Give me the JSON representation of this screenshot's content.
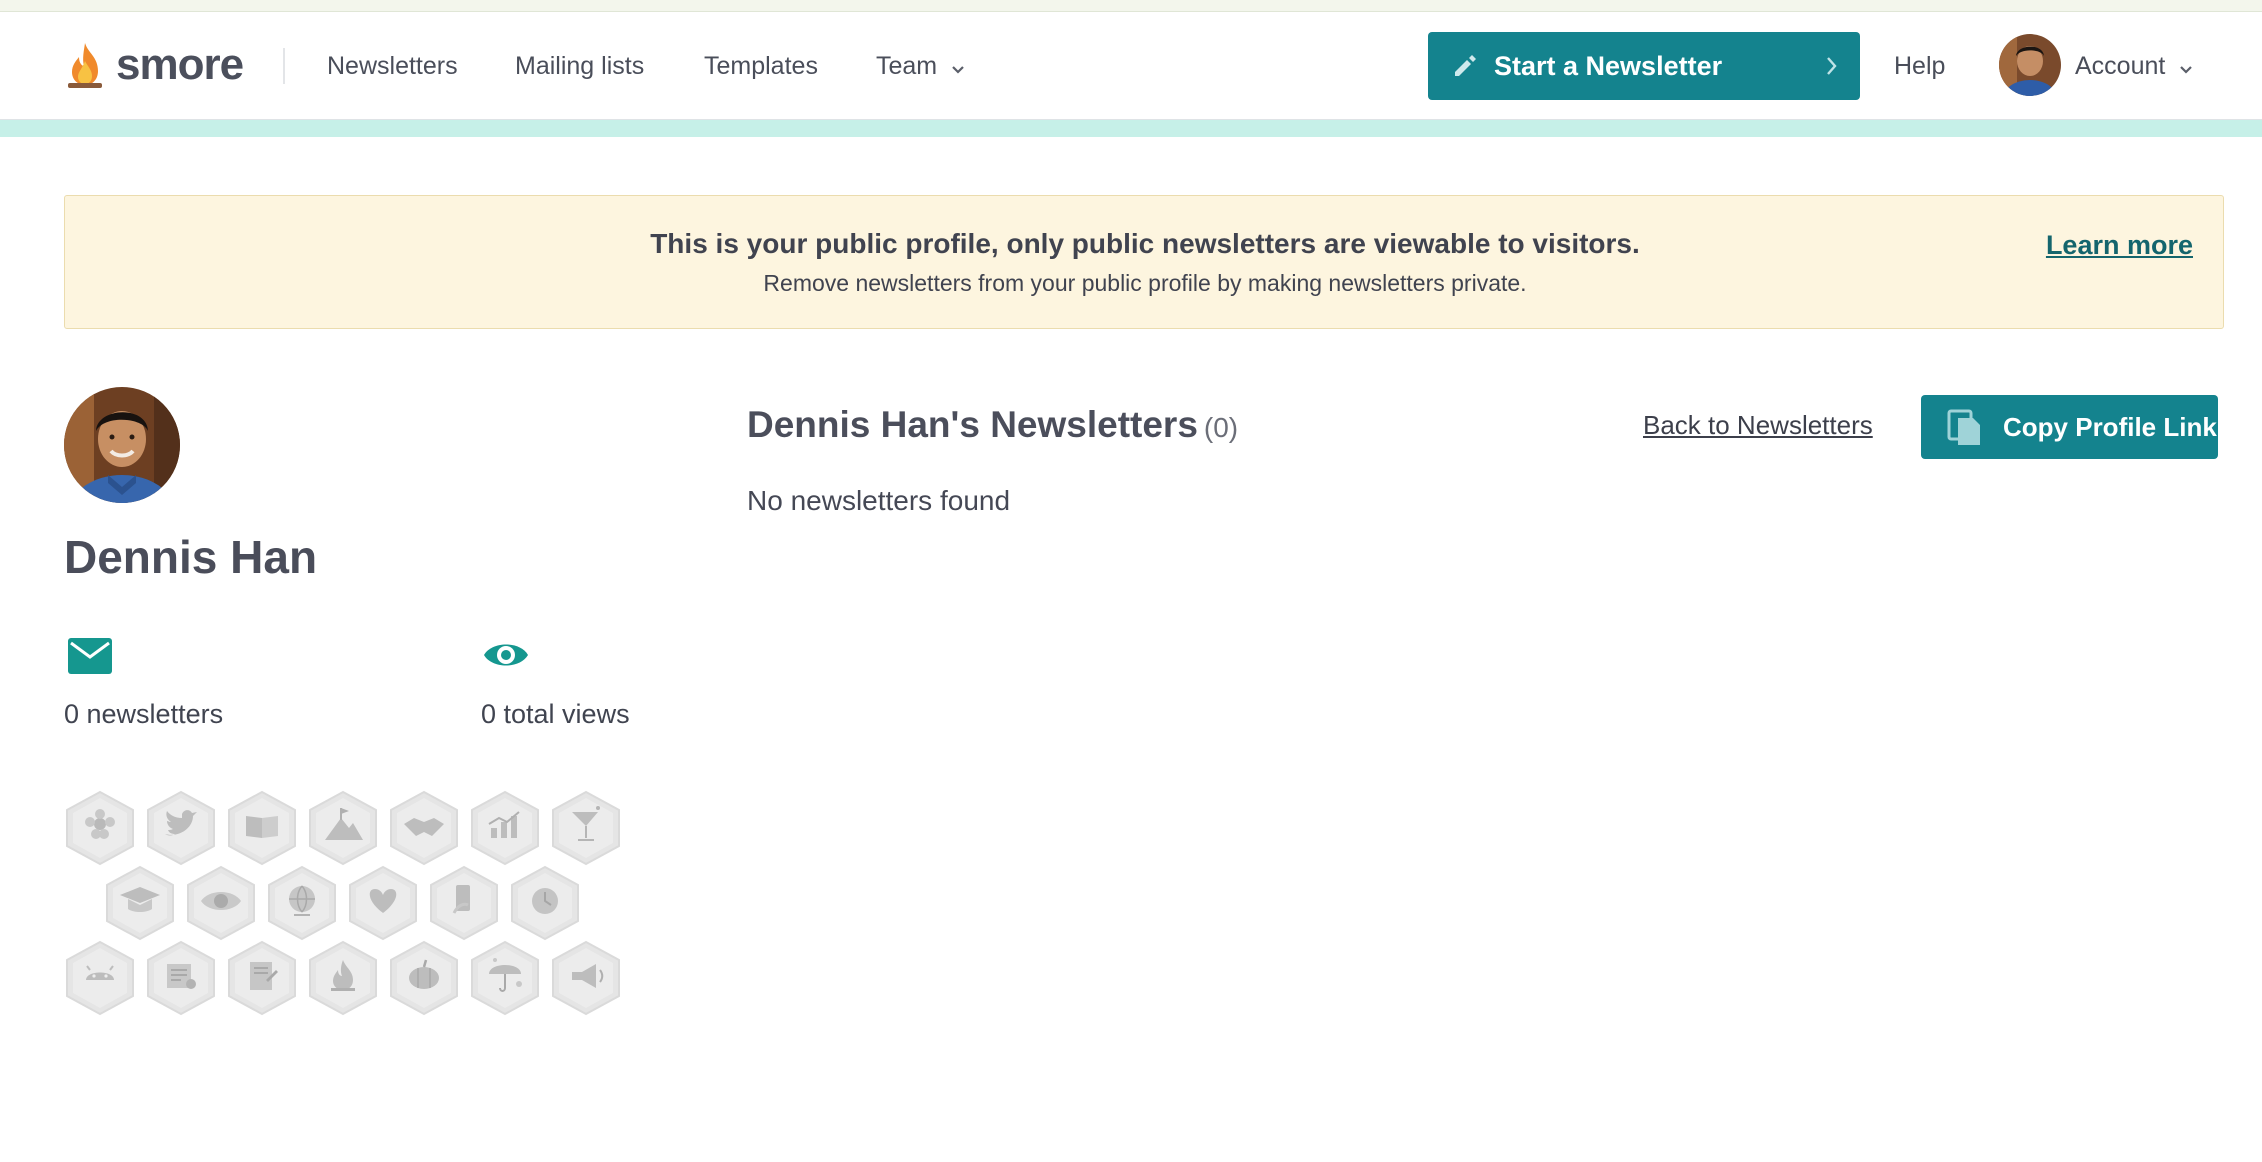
{
  "brand": {
    "name": "smore",
    "accent": "#14838e",
    "logo_icon": "flame-icon"
  },
  "nav": {
    "items": [
      {
        "label": "Newsletters"
      },
      {
        "label": "Mailing lists"
      },
      {
        "label": "Templates"
      },
      {
        "label": "Team",
        "icon": "chevron-down-icon"
      }
    ],
    "start_button": {
      "label": "Start a Newsletter",
      "icon": "pencil-icon",
      "trailing_icon": "chevron-right-icon"
    },
    "help": "Help",
    "account": {
      "label": "Account",
      "icon": "chevron-down-icon"
    }
  },
  "notice": {
    "title": "This is your public profile, only public newsletters are viewable to visitors.",
    "subtitle": "Remove newsletters from your public profile by making newsletters private.",
    "link": "Learn more",
    "background": "#fdf5df"
  },
  "profile": {
    "name": "Dennis Han",
    "stats": [
      {
        "icon": "envelope-icon",
        "text": "0 newsletters"
      },
      {
        "icon": "eye-icon",
        "text": "0 total views"
      }
    ],
    "badges": [
      [
        "flower-badge-icon",
        "twitter-badge-icon",
        "book-badge-icon",
        "mountain-flag-badge-icon",
        "handshake-badge-icon",
        "chart-badge-icon",
        "cocktail-badge-icon"
      ],
      [
        "graduation-cap-badge-icon",
        "eye-badge-icon",
        "globe-badge-icon",
        "heart-badge-icon",
        "phone-badge-icon",
        "clock-badge-icon"
      ],
      [
        "android-badge-icon",
        "newspaper-badge-icon",
        "document-badge-icon",
        "flame-badge-icon",
        "pumpkin-badge-icon",
        "umbrella-badge-icon",
        "megaphone-badge-icon"
      ]
    ]
  },
  "main": {
    "title": "Dennis Han's Newsletters",
    "count": "(0)",
    "empty_text": "No newsletters found",
    "back_link": "Back to Newsletters",
    "copy_button": {
      "label": "Copy Profile Link",
      "icon": "copy-icon"
    }
  }
}
